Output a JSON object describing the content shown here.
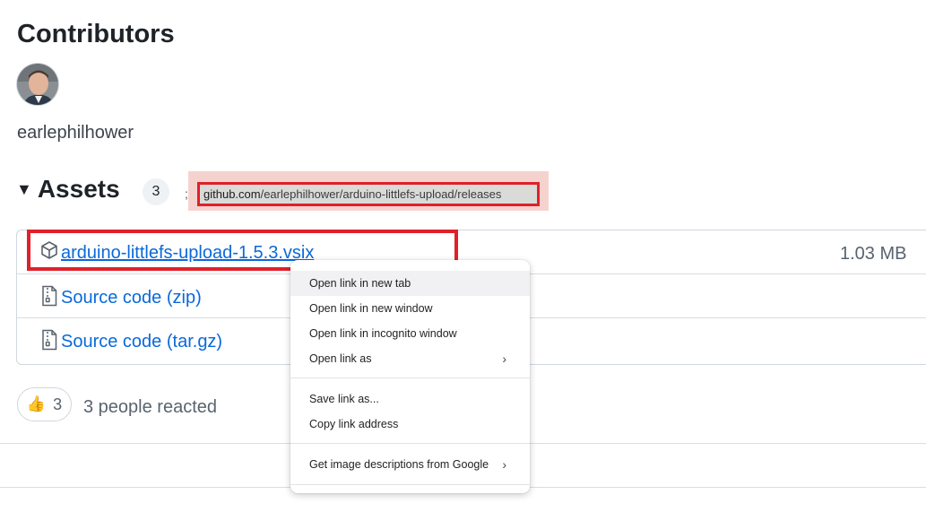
{
  "contributors": {
    "title": "Contributors",
    "users": [
      {
        "name": "earlephilhower"
      }
    ]
  },
  "assets": {
    "title": "Assets",
    "count": "3",
    "caret_icon": "triangle-down-icon",
    "items": [
      {
        "name": "arduino-littlefs-upload-1.5.3.vsix",
        "size": "1.03 MB",
        "icon": "package-icon"
      },
      {
        "name": "Source code",
        "suffix": "(zip)",
        "icon": "file-zip-icon"
      },
      {
        "name": "Source code",
        "suffix": "(tar.gz)",
        "icon": "file-zip-icon"
      }
    ]
  },
  "url_overlay": {
    "separator": ";",
    "domain": "github.com",
    "path": "/earlephilhower/arduino-littlefs-upload/releases"
  },
  "reactions": {
    "emoji": "👍",
    "count": "3",
    "summary": "3 people reacted"
  },
  "context_menu": {
    "items": [
      {
        "label": "Open link in new tab",
        "submenu": false,
        "hovered": true
      },
      {
        "label": "Open link in new window",
        "submenu": false
      },
      {
        "label": "Open link in incognito window",
        "submenu": false
      },
      {
        "label": "Open link as",
        "submenu": true,
        "arrow": "›"
      },
      {
        "label": "Save link as...",
        "submenu": false
      },
      {
        "label": "Copy link address",
        "submenu": false
      },
      {
        "label": "Get image descriptions from Google",
        "submenu": true,
        "arrow": "›"
      }
    ]
  },
  "colors": {
    "link": "#0969da",
    "highlight_border": "#e0202a",
    "text": "#1f2328",
    "muted": "#59636e"
  }
}
